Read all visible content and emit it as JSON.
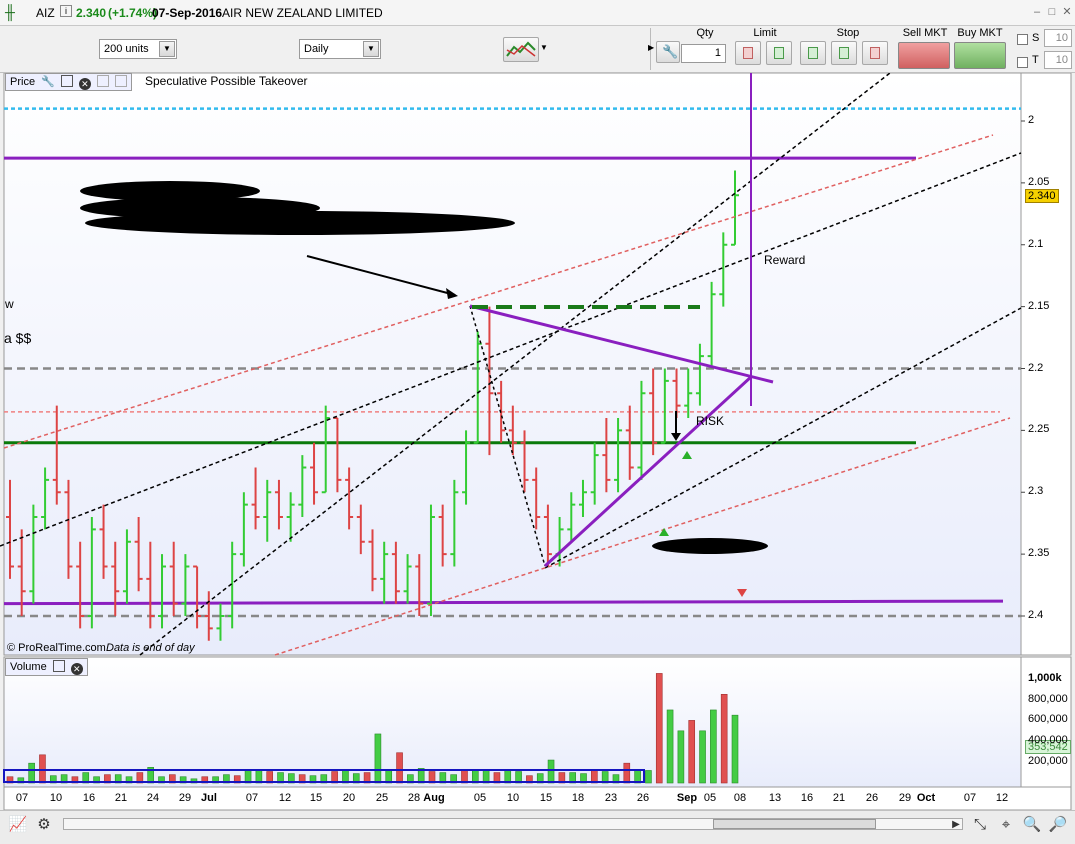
{
  "window": {
    "symbol": "AIZ",
    "price": "2.340",
    "change": "(+1.74%)",
    "date": "07-Sep-2016",
    "company": "AIR NEW ZEALAND LIMITED"
  },
  "toolbar": {
    "units": "200 units",
    "period": "Daily",
    "qty_label": "Qty",
    "qty_value": "1",
    "limit_label": "Limit",
    "stop_label": "Stop",
    "sell_label": "Sell MKT",
    "buy_label": "Buy MKT",
    "s_label": "S",
    "t_label": "T",
    "s_value": "10",
    "t_value": "10"
  },
  "price_panel": {
    "tab_label": "Price",
    "annotation": "Speculative Possible Takeover",
    "reward_label": "Reward",
    "risk_label": "RISK",
    "left_text_1": "w",
    "left_text_2": "a $$",
    "copyright": "© ProRealTime.com",
    "footnote": "Data is end of day",
    "current_price_badge": "2.340",
    "y_ticks": [
      "2.4",
      "2.35",
      "2.3",
      "2.25",
      "2.2",
      "2.15",
      "2.1",
      "2.05",
      "2"
    ]
  },
  "volume_panel": {
    "tab_label": "Volume",
    "y_ticks": [
      "1,000k",
      "800,000",
      "600,000",
      "400,000",
      "200,000"
    ],
    "current_volume_badge": "353,542"
  },
  "x_axis": [
    "07",
    "10",
    "16",
    "21",
    "24",
    "29",
    "Jul",
    "07",
    "12",
    "15",
    "20",
    "25",
    "28",
    "Aug",
    "05",
    "10",
    "15",
    "18",
    "23",
    "26",
    "Sep",
    "05",
    "08",
    "13",
    "16",
    "21",
    "26",
    "29",
    "Oct",
    "07",
    "12"
  ],
  "colors": {
    "up": "#33cc33",
    "down": "#dd4444",
    "purple": "#8a1fbf",
    "green_line": "#0a7a0a",
    "cyan": "#33bbee"
  },
  "chart_data": {
    "type": "ohlc",
    "ylim": [
      1.98,
      2.44
    ],
    "y_ticks": [
      2.0,
      2.05,
      2.1,
      2.15,
      2.2,
      2.25,
      2.3,
      2.35,
      2.4
    ],
    "levels": {
      "cyan_dotted": 2.41,
      "purple_top": 2.37,
      "grey_dashed_mid": 2.2,
      "pink_dashed": 2.165,
      "green_solid": 2.14,
      "grey_dashed_low": 2.0,
      "purple_bottom": 2.01
    },
    "x_categories": [
      "07",
      "10",
      "16",
      "21",
      "24",
      "29",
      "Jul",
      "07",
      "12",
      "15",
      "20",
      "25",
      "28",
      "Aug",
      "05",
      "10",
      "15",
      "18",
      "23",
      "26",
      "Sep",
      "05",
      "08",
      "13",
      "16",
      "21",
      "26",
      "29",
      "Oct",
      "07",
      "12"
    ],
    "ohlc": [
      [
        2.08,
        2.11,
        2.03,
        2.04
      ],
      [
        2.04,
        2.07,
        2.0,
        2.02
      ],
      [
        2.02,
        2.09,
        2.01,
        2.08
      ],
      [
        2.08,
        2.12,
        2.07,
        2.11
      ],
      [
        2.11,
        2.17,
        2.09,
        2.1
      ],
      [
        2.1,
        2.11,
        2.03,
        2.04
      ],
      [
        2.04,
        2.06,
        1.99,
        2.0
      ],
      [
        2.0,
        2.08,
        1.99,
        2.07
      ],
      [
        2.07,
        2.09,
        2.03,
        2.04
      ],
      [
        2.04,
        2.06,
        2.0,
        2.02
      ],
      [
        2.02,
        2.07,
        2.01,
        2.06
      ],
      [
        2.06,
        2.08,
        2.02,
        2.03
      ],
      [
        2.03,
        2.06,
        1.99,
        2.0
      ],
      [
        2.0,
        2.05,
        1.99,
        2.04
      ],
      [
        2.04,
        2.06,
        2.0,
        2.01
      ],
      [
        2.01,
        2.05,
        2.0,
        2.04
      ],
      [
        2.04,
        2.04,
        1.99,
        2.0
      ],
      [
        2.0,
        2.02,
        1.98,
        1.99
      ],
      [
        1.99,
        2.01,
        1.98,
        2.0
      ],
      [
        2.0,
        2.06,
        1.99,
        2.05
      ],
      [
        2.05,
        2.1,
        2.04,
        2.09
      ],
      [
        2.09,
        2.12,
        2.07,
        2.08
      ],
      [
        2.08,
        2.11,
        2.06,
        2.1
      ],
      [
        2.1,
        2.11,
        2.07,
        2.08
      ],
      [
        2.08,
        2.1,
        2.06,
        2.09
      ],
      [
        2.09,
        2.13,
        2.08,
        2.12
      ],
      [
        2.12,
        2.14,
        2.09,
        2.1
      ],
      [
        2.1,
        2.17,
        2.1,
        2.16
      ],
      [
        2.16,
        2.16,
        2.1,
        2.11
      ],
      [
        2.11,
        2.12,
        2.07,
        2.08
      ],
      [
        2.08,
        2.09,
        2.05,
        2.06
      ],
      [
        2.06,
        2.07,
        2.02,
        2.03
      ],
      [
        2.03,
        2.06,
        2.01,
        2.05
      ],
      [
        2.05,
        2.06,
        2.01,
        2.02
      ],
      [
        2.02,
        2.05,
        2.01,
        2.04
      ],
      [
        2.04,
        2.05,
        2.0,
        2.01
      ],
      [
        2.01,
        2.09,
        2.0,
        2.08
      ],
      [
        2.08,
        2.09,
        2.04,
        2.05
      ],
      [
        2.05,
        2.11,
        2.04,
        2.1
      ],
      [
        2.1,
        2.15,
        2.09,
        2.14
      ],
      [
        2.14,
        2.23,
        2.14,
        2.22
      ],
      [
        2.22,
        2.25,
        2.13,
        2.18
      ],
      [
        2.18,
        2.19,
        2.14,
        2.15
      ],
      [
        2.15,
        2.17,
        2.13,
        2.14
      ],
      [
        2.14,
        2.15,
        2.1,
        2.11
      ],
      [
        2.11,
        2.12,
        2.07,
        2.08
      ],
      [
        2.08,
        2.09,
        2.04,
        2.05
      ],
      [
        2.05,
        2.08,
        2.04,
        2.07
      ],
      [
        2.07,
        2.1,
        2.06,
        2.09
      ],
      [
        2.09,
        2.11,
        2.08,
        2.1
      ],
      [
        2.1,
        2.14,
        2.09,
        2.13
      ],
      [
        2.13,
        2.16,
        2.1,
        2.11
      ],
      [
        2.11,
        2.16,
        2.1,
        2.15
      ],
      [
        2.15,
        2.17,
        2.11,
        2.12
      ],
      [
        2.12,
        2.19,
        2.11,
        2.18
      ],
      [
        2.18,
        2.2,
        2.13,
        2.14
      ],
      [
        2.14,
        2.2,
        2.14,
        2.19
      ],
      [
        2.19,
        2.2,
        2.16,
        2.17
      ],
      [
        2.17,
        2.2,
        2.16,
        2.18
      ],
      [
        2.18,
        2.22,
        2.17,
        2.21
      ],
      [
        2.21,
        2.27,
        2.2,
        2.26
      ],
      [
        2.26,
        2.31,
        2.25,
        2.3
      ],
      [
        2.3,
        2.36,
        2.3,
        2.34
      ]
    ],
    "volume": [
      60,
      50,
      190,
      270,
      70,
      80,
      60,
      100,
      60,
      80,
      80,
      60,
      100,
      150,
      60,
      80,
      60,
      40,
      60,
      60,
      80,
      70,
      120,
      120,
      110,
      100,
      90,
      80,
      70,
      80,
      110,
      120,
      90,
      100,
      470,
      130,
      290,
      80,
      140,
      110,
      100,
      80,
      120,
      120,
      120,
      100,
      130,
      110,
      70,
      90,
      220,
      100,
      100,
      90,
      120,
      110,
      80,
      190,
      130,
      120,
      1050,
      700,
      500,
      600,
      500,
      700,
      850,
      650
    ],
    "volume_ylim": [
      0,
      1150000
    ]
  }
}
